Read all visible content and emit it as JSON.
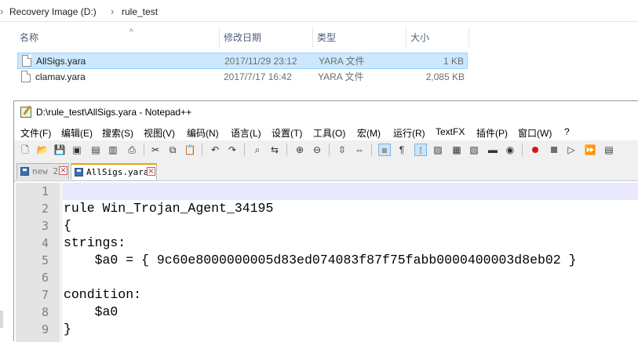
{
  "explorer": {
    "breadcrumb": [
      "Recovery Image (D:)",
      "rule_test"
    ],
    "columns": {
      "name": "名称",
      "modified": "修改日期",
      "type": "类型",
      "size": "大小"
    },
    "files": [
      {
        "name": "AllSigs.yara",
        "modified": "2017/11/29 23:12",
        "type": "YARA 文件",
        "size": "1 KB",
        "selected": true
      },
      {
        "name": "clamav.yara",
        "modified": "2017/7/17 16:42",
        "type": "YARA 文件",
        "size": "2,085 KB",
        "selected": false
      }
    ]
  },
  "notepad": {
    "title": "D:\\rule_test\\AllSigs.yara - Notepad++",
    "menu": [
      "文件(F)",
      "编辑(E)",
      "搜索(S)",
      "视图(V)",
      "编码(N)",
      "语言(L)",
      "设置(T)",
      "工具(O)",
      "宏(M)",
      "运行(R)",
      "TextFX",
      "插件(P)",
      "窗口(W)",
      "?"
    ],
    "tabs": [
      {
        "label": "new 2",
        "active": false
      },
      {
        "label": "AllSigs.yara",
        "active": true
      }
    ],
    "line_numbers": [
      "1",
      "2",
      "3",
      "4",
      "5",
      "6",
      "7",
      "8",
      "9"
    ],
    "lines": [
      "",
      "rule Win_Trojan_Agent_34195",
      "{",
      "strings:",
      "    $a0 = { 9c60e8000000005d83ed074083f87f75fabb0000400003d8eb02 }",
      "",
      "condition:",
      "    $a0",
      "}"
    ]
  },
  "toolbar_icons": [
    "new-file-icon",
    "open-file-icon",
    "save-icon",
    "save-all-icon",
    "close-icon",
    "close-all-icon",
    "print-icon",
    "cut-icon",
    "copy-icon",
    "paste-icon",
    "undo-icon",
    "redo-icon",
    "find-icon",
    "replace-icon",
    "zoom-in-icon",
    "zoom-out-icon",
    "sync-vertical-icon",
    "sync-horizontal-icon",
    "word-wrap-icon",
    "show-all-chars-icon",
    "indent-guide-icon",
    "user-language-icon",
    "function-list-icon",
    "doc-map-icon",
    "folder-workspace-icon",
    "monitor-icon",
    "record-macro-icon",
    "stop-macro-icon",
    "play-macro-icon",
    "run-macro-multiple-icon",
    "save-macro-icon"
  ],
  "colors": {
    "selection": "#cce8ff",
    "current_line": "#e8e8ff",
    "active_tab_accent": "#f0a000"
  }
}
